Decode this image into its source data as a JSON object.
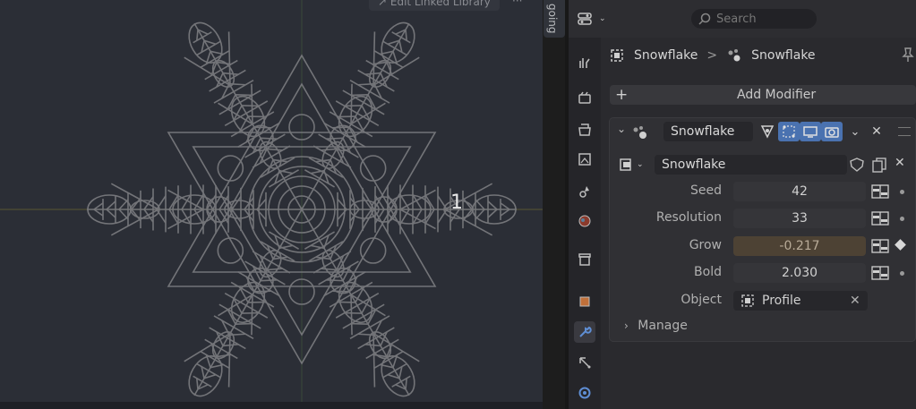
{
  "viewport": {
    "header_button": "Edit Linked Library",
    "header_more": "···",
    "side_tab": "going",
    "overlay_number": "1"
  },
  "properties": {
    "search_placeholder": "Search",
    "breadcrumb": {
      "object": "Snowflake",
      "separator": ">",
      "data": "Snowflake"
    },
    "add_modifier_label": "Add Modifier",
    "modifier": {
      "name": "Snowflake",
      "node_group": "Snowflake",
      "params": [
        {
          "label": "Seed",
          "value": "42",
          "state": "normal"
        },
        {
          "label": "Resolution",
          "value": "33",
          "state": "normal"
        },
        {
          "label": "Grow",
          "value": "-0.217",
          "state": "animated"
        },
        {
          "label": "Bold",
          "value": "2.030",
          "state": "normal"
        }
      ],
      "object_label": "Object",
      "object_value": "Profile",
      "manage_label": "Manage"
    }
  },
  "colors": {
    "viewport_bg": "#2b2e36",
    "panel_bg": "#303034",
    "accent": "#4a72b0",
    "animated_field": "#4d4234"
  }
}
